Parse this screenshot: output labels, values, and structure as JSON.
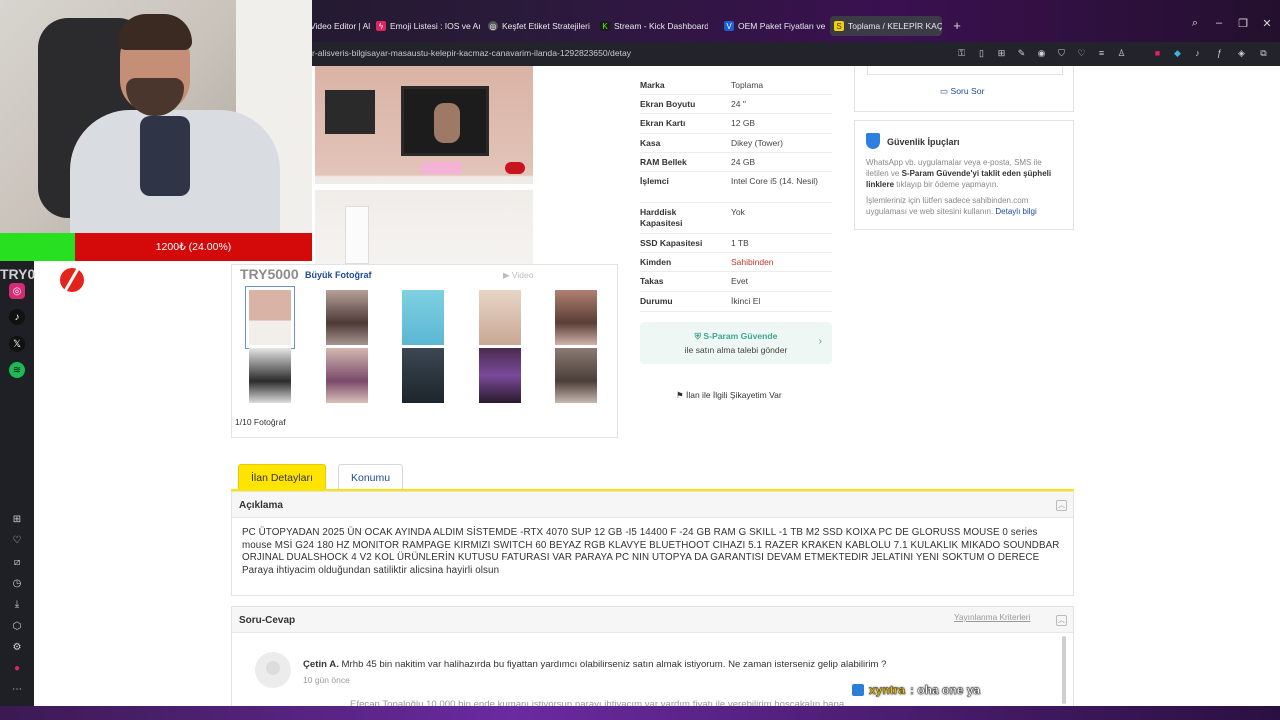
{
  "browser": {
    "tabs": [
      {
        "label": "Video Editor | All",
        "color": "#555"
      },
      {
        "label": "Emoji Listesi : IOS ve Andr",
        "color": "#e0245e"
      },
      {
        "label": "Keşfet Etiket Stratejileri",
        "color": "#777"
      },
      {
        "label": "Stream - Kick Dashboard",
        "color": "#53fc18"
      },
      {
        "label": "OEM Paket Fiyatları ve Mo",
        "color": "#1b5fd1"
      },
      {
        "label": "Toplama / KELEPİR KAÇMA",
        "color": "#f6d100"
      }
    ],
    "new_tab": "+",
    "url": "r-alisveris-bilgisayar-masaustu-kelepir-kacmaz-canavarim-ilanda-1292823650/detay"
  },
  "overlay": {
    "donation_bar_text": "1200₺ (24.00%)",
    "donation_progress": 0.24,
    "goal_left": "TRY0",
    "goal_right": "TRY5000",
    "chat_user": "xyntra",
    "chat_text": ": oha one ya"
  },
  "gallery": {
    "big_photo_label": "Büyük Fotoğraf",
    "video_label": "Video",
    "count": "1/10 Fotoğraf"
  },
  "specs": [
    {
      "k": "Marka",
      "v": "Toplama"
    },
    {
      "k": "Ekran Boyutu",
      "v": "24 \""
    },
    {
      "k": "Ekran Kartı",
      "v": "12 GB"
    },
    {
      "k": "Kasa",
      "v": "Dikey (Tower)"
    },
    {
      "k": "RAM Bellek",
      "v": "24 GB"
    },
    {
      "k": "İşlemci",
      "v": "Intel Core i5 (14. Nesil)"
    },
    {
      "k": "Harddisk Kapasitesi",
      "v": "Yok"
    },
    {
      "k": "SSD Kapasitesi",
      "v": "1 TB"
    },
    {
      "k": "Kimden",
      "v": "Sahibinden"
    },
    {
      "k": "Takas",
      "v": "Evet"
    },
    {
      "k": "Durumu",
      "v": "İkinci El"
    }
  ],
  "sparam": {
    "title": "S-Param Güvende",
    "subtitle": "ile satın alma talebi gönder"
  },
  "complain": "İlan ile İlgili Şikayetim Var",
  "sidebox": {
    "ask": "Soru Sor",
    "safety_title": "Güvenlik İpuçları",
    "safety_p1_a": "WhatsApp vb. uygulamalar veya e-posta, SMS ile iletilen ve ",
    "safety_p1_b": "S-Param Güvende'yi taklit eden şüpheli linklere",
    "safety_p1_c": " tıklayıp bir ödeme yapmayın.",
    "safety_p2_a": "İşlemleriniz için lütfen sadece sahibinden.com uygulaması ve web sitesini kullanın. ",
    "safety_p2_link": "Detaylı bilgi"
  },
  "page_tabs": {
    "details": "İlan Detayları",
    "location": "Konumu"
  },
  "description": {
    "heading": "Açıklama",
    "text": "PC ÜTOPYADAN 2025 ÜN OCAK AYINDA ALDIM SİSTEMDE -RTX 4070 SUP 12 GB -I5 14400 F -24 GB RAM G SKILL -1 TB M2 SSD KOIXA PC DE GLORUSS MOUSE 0 series mouse MSİ G24 180 HZ MONITOR RAMPAGE KIRMIZI SWITCH 60 BEYAZ RGB KLAVYE BLUETHOOT CIHAZI 5.1 RAZER KRAKEN KABLOLU 7.1 KULAKLIK MIKADO SOUNDBAR ORJINAL DUALSHOCK 4 V2 KOL ÜRÜNLERİN KUTUSU FATURASI VAR PARAYA PC NIN UTOPYA DA GARANTISI DEVAM ETMEKTEDIR JELATINI YENI SOKTUM O DERECE Paraya ihtiyacim olduğundan satiliktir alicsina hayirli olsun"
  },
  "qa": {
    "heading": "Soru-Cevap",
    "criteria": "Yayınlanma Kriterleri",
    "q_user": "Çetin A.",
    "q_text": " Mrhb 45 bin nakitim var halihazırda bu fiyattan yardımcı olabilirseniz satın almak istiyorum. Ne zaman isterseniz gelip alabilirim ?",
    "q_time": "10 gün önce",
    "answer_preview": "Efecan Topaloğlu 10.000 bin ende kumanı istiyorsun parayı ihtiyacım var yardım fiyatı ile verebilirim hoşçakalın bana"
  }
}
